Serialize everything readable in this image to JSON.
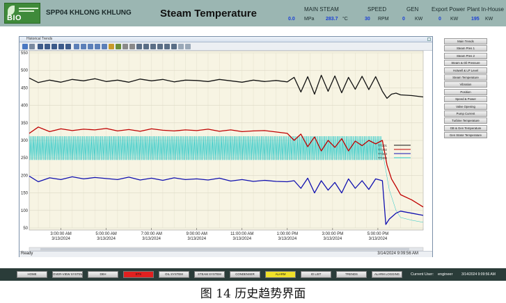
{
  "header": {
    "logo_text": "BIO",
    "plant_name": "SPP04 KHLONG KHLUNG",
    "title": "Steam Temperature",
    "main_steam_label": "MAIN STEAM",
    "main_steam_pressure": "0.0",
    "main_steam_pressure_unit": "MPa",
    "main_steam_temp": "283.7",
    "main_steam_temp_unit": "°C",
    "speed_label": "SPEED",
    "speed_value": "30",
    "speed_unit": "RPM",
    "gen_label": "GEN",
    "gen_value": "0",
    "gen_unit": "KW",
    "export_label": "Export Power",
    "export_value": "0",
    "export_unit": "KW",
    "inhouse_label": "Plant In-House",
    "inhouse_value": "195",
    "inhouse_unit": "KW"
  },
  "window": {
    "title": "Historical Trends",
    "status_left": "Ready",
    "status_time": "3/14/2024 9:09:56 AM"
  },
  "chart_data": {
    "type": "line",
    "ylim": [
      50,
      550
    ],
    "yticks": [
      50,
      100,
      150,
      200,
      250,
      300,
      350,
      400,
      450,
      500,
      550
    ],
    "xticks": [
      {
        "time": "3:00:00 AM",
        "date": "3/13/2024"
      },
      {
        "time": "5:00:00 AM",
        "date": "3/13/2024"
      },
      {
        "time": "7:00:00 AM",
        "date": "3/13/2024"
      },
      {
        "time": "9:00:00 AM",
        "date": "3/13/2024"
      },
      {
        "time": "11:00:00 AM",
        "date": "3/13/2024"
      },
      {
        "time": "1:00:00 PM",
        "date": "3/13/2024"
      },
      {
        "time": "3:00:00 PM",
        "date": "3/13/2024"
      },
      {
        "time": "5:00:00 PM",
        "date": "3/13/2024"
      }
    ],
    "xrange": [
      1.6,
      19.0
    ],
    "legend": [
      "TT301",
      "TT302",
      "TT303",
      "TT304"
    ],
    "series": [
      {
        "name": "TT301",
        "color": "#111111",
        "t": [
          1.6,
          2.0,
          2.5,
          3.0,
          3.5,
          4.0,
          4.5,
          5.0,
          5.5,
          6.0,
          6.5,
          7.0,
          7.5,
          8.0,
          8.5,
          9.0,
          9.5,
          10.0,
          10.5,
          11.0,
          11.5,
          12.0,
          12.5,
          13.0,
          13.3,
          13.6,
          13.9,
          14.2,
          14.5,
          14.8,
          15.1,
          15.4,
          15.7,
          16.0,
          16.3,
          16.6,
          16.9,
          17.2,
          17.4,
          17.6,
          17.8,
          18.0,
          18.5,
          19.0
        ],
        "v": [
          478,
          465,
          472,
          466,
          474,
          470,
          476,
          468,
          472,
          466,
          475,
          470,
          474,
          467,
          472,
          471,
          468,
          474,
          470,
          466,
          472,
          468,
          471,
          467,
          480,
          438,
          482,
          432,
          486,
          440,
          484,
          436,
          480,
          446,
          483,
          445,
          482,
          440,
          420,
          432,
          435,
          430,
          428,
          424
        ]
      },
      {
        "name": "TT302",
        "color": "#c00000",
        "t": [
          1.6,
          2.0,
          2.5,
          3.0,
          3.5,
          4.0,
          4.5,
          5.0,
          5.5,
          6.0,
          6.5,
          7.0,
          7.5,
          8.0,
          8.5,
          9.0,
          9.5,
          10.0,
          10.5,
          11.0,
          11.5,
          12.0,
          12.5,
          13.0,
          13.3,
          13.6,
          13.9,
          14.2,
          14.5,
          14.8,
          15.1,
          15.4,
          15.7,
          16.0,
          16.3,
          16.6,
          16.9,
          17.2,
          17.4,
          17.6,
          17.8,
          18.0,
          18.5,
          19.0
        ],
        "v": [
          320,
          338,
          325,
          333,
          328,
          332,
          330,
          334,
          327,
          331,
          326,
          333,
          329,
          327,
          330,
          328,
          332,
          326,
          330,
          325,
          327,
          328,
          324,
          320,
          300,
          318,
          282,
          310,
          270,
          300,
          280,
          305,
          270,
          298,
          285,
          300,
          290,
          300,
          230,
          190,
          168,
          145,
          130,
          110
        ]
      },
      {
        "name": "TT303",
        "color": "#1010b0",
        "t": [
          1.6,
          2.0,
          2.5,
          3.0,
          3.5,
          4.0,
          4.5,
          5.0,
          5.5,
          6.0,
          6.5,
          7.0,
          7.5,
          8.0,
          8.5,
          9.0,
          9.5,
          10.0,
          10.5,
          11.0,
          11.5,
          12.0,
          12.5,
          13.0,
          13.3,
          13.6,
          13.9,
          14.2,
          14.5,
          14.8,
          15.1,
          15.4,
          15.7,
          16.0,
          16.3,
          16.6,
          16.9,
          17.2,
          17.35,
          17.5,
          17.8,
          18.0,
          18.5,
          19.0
        ],
        "v": [
          198,
          182,
          193,
          188,
          196,
          190,
          194,
          191,
          188,
          195,
          187,
          192,
          186,
          193,
          188,
          190,
          187,
          192,
          184,
          188,
          183,
          186,
          183,
          182,
          185,
          163,
          192,
          150,
          185,
          158,
          180,
          150,
          190,
          163,
          185,
          160,
          190,
          185,
          60,
          75,
          92,
          98,
          92,
          86
        ]
      },
      {
        "name": "TT304",
        "color": "#22c7c7",
        "t": [
          1.6,
          17.2,
          17.5,
          17.8,
          18.0,
          18.5,
          19.0
        ],
        "v": [
          270,
          270,
          160,
          100,
          80,
          72,
          66
        ],
        "band": [
          244,
          312
        ]
      }
    ]
  },
  "nav": [
    "Main Trends",
    "Steam Pres 1",
    "Steam Pres 2",
    "Steam & Oil Pressure",
    "Hotwell & LP Level",
    "Steam Temperature",
    "Vibration",
    "Position",
    "Speed & Power",
    "Valve Opening",
    "Pump Current",
    "Turbine Temperature",
    "GB & Gen Temperature",
    "Gen Stator Temperature"
  ],
  "bottom_buttons": [
    {
      "label": "HOME",
      "color": "#d9d9d9"
    },
    {
      "label": "OVER-VIEW SYSTEM",
      "color": "#d9d9d9"
    },
    {
      "label": "DEH",
      "color": "#d9d9d9"
    },
    {
      "label": "ETS",
      "color": "#e02020"
    },
    {
      "label": "OIL SYSTEM",
      "color": "#d9d9d9"
    },
    {
      "label": "STEAM SYSTEM",
      "color": "#d9d9d9"
    },
    {
      "label": "CONDENSER",
      "color": "#d9d9d9"
    },
    {
      "label": "ALARM",
      "color": "#f0e02a"
    },
    {
      "label": "IO LIST",
      "color": "#d9d9d9"
    },
    {
      "label": "TRENDS",
      "color": "#d9d9d9"
    },
    {
      "label": "ALARM LOGGING",
      "color": "#d9d9d9"
    }
  ],
  "bottom": {
    "user_label": "Current User:",
    "user": "engineer",
    "time": "3/14/2024 9:09:56 AM"
  },
  "caption": "图 14  历史趋势界面"
}
